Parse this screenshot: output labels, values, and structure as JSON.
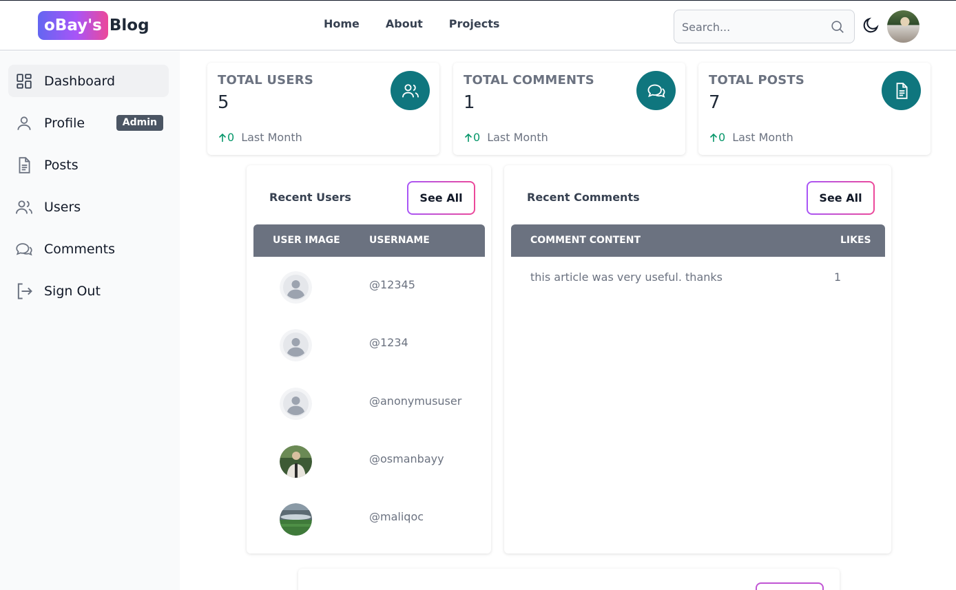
{
  "header": {
    "logo_badge": "oBay's",
    "logo_text": "Blog",
    "nav": [
      "Home",
      "About",
      "Projects"
    ],
    "search_placeholder": "Search..."
  },
  "sidebar": {
    "items": [
      {
        "label": "Dashboard",
        "icon": "dashboard-icon",
        "active": true
      },
      {
        "label": "Profile",
        "icon": "user-icon",
        "badge": "Admin"
      },
      {
        "label": "Posts",
        "icon": "document-icon"
      },
      {
        "label": "Users",
        "icon": "users-icon"
      },
      {
        "label": "Comments",
        "icon": "comments-icon"
      },
      {
        "label": "Sign Out",
        "icon": "sign-out-icon"
      }
    ]
  },
  "stats": [
    {
      "title": "TOTAL USERS",
      "value": "5",
      "change": "0",
      "period": "Last Month",
      "icon": "users-icon"
    },
    {
      "title": "TOTAL COMMENTS",
      "value": "1",
      "change": "0",
      "period": "Last Month",
      "icon": "comments-icon"
    },
    {
      "title": "TOTAL POSTS",
      "value": "7",
      "change": "0",
      "period": "Last Month",
      "icon": "document-icon"
    }
  ],
  "recent_users": {
    "title": "Recent Users",
    "see_all": "See All",
    "columns": [
      "USER IMAGE",
      "USERNAME"
    ],
    "rows": [
      {
        "username": "@12345",
        "avatar": "default-avatar"
      },
      {
        "username": "@1234",
        "avatar": "default-avatar"
      },
      {
        "username": "@anonymususer",
        "avatar": "default-avatar"
      },
      {
        "username": "@osmanbayy",
        "avatar": "photo-avatar"
      },
      {
        "username": "@maliqoc",
        "avatar": "stadium-avatar"
      }
    ]
  },
  "recent_comments": {
    "title": "Recent Comments",
    "see_all": "See All",
    "columns": [
      "COMMENT CONTENT",
      "LIKES"
    ],
    "rows": [
      {
        "content": "this article was very useful. thanks",
        "likes": "1"
      }
    ]
  },
  "colors": {
    "accent_teal": "#0f767e",
    "gradient_start": "#6366f1",
    "gradient_end": "#ec4899",
    "positive": "#059669",
    "table_header": "#6b7280"
  }
}
